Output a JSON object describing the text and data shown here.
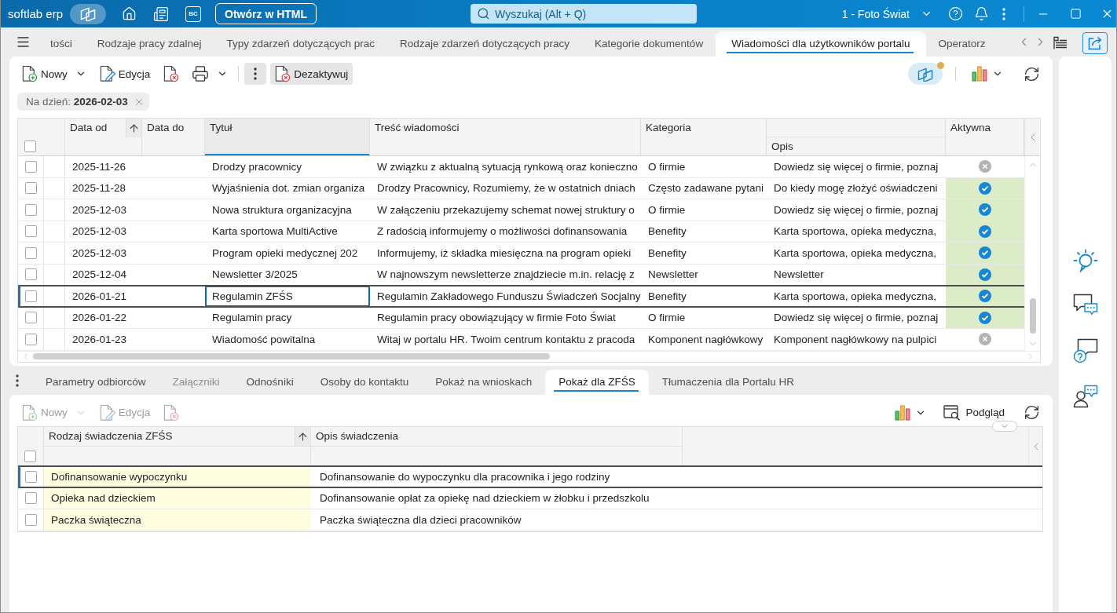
{
  "titlebar": {
    "brand": "softlab erp",
    "bc_badge": "BC",
    "open_html": "Otwórz w HTML",
    "search": {
      "placeholder": "Wyszukaj (Alt + Q)"
    },
    "company": "1 - Foto Świat"
  },
  "tabs": [
    {
      "label": "tości",
      "selected": false
    },
    {
      "label": "Rodzaje pracy zdalnej",
      "selected": false
    },
    {
      "label": "Typy zdarzeń dotyczących prac",
      "selected": false
    },
    {
      "label": "Rodzaje zdarzeń dotyczących pracy",
      "selected": false
    },
    {
      "label": "Kategorie dokumentów",
      "selected": false
    },
    {
      "label": "Wiadomości dla użytkowników portalu",
      "selected": true
    },
    {
      "label": "Operatorz",
      "selected": false
    }
  ],
  "toolbar": {
    "groups": [
      [
        {
          "kind": "new",
          "label": "Nowy",
          "menu": true,
          "disabled": false
        },
        {
          "kind": "edit",
          "label": "Edycja",
          "menu": false,
          "disabled": false
        },
        {
          "kind": "delete",
          "menu": false,
          "disabled": false
        },
        {
          "kind": "print",
          "menu": true,
          "disabled": false
        }
      ],
      [
        {
          "kind": "more",
          "menu": false,
          "disabled": false
        },
        {
          "kind": "deactivate",
          "label": "Dezaktywuj",
          "menu": false,
          "disabled": false
        }
      ]
    ],
    "views_badge": true
  },
  "filter": {
    "text": "Na dzień: **2026-02-03**"
  },
  "grid": {
    "select_all": {
      "checked": false
    },
    "columns": [
      {
        "label": "Data od",
        "kind": "upper",
        "sorted": true,
        "selected": false
      },
      {
        "label": "Data do",
        "kind": "upper",
        "sorted": false,
        "selected": false
      },
      {
        "label": "Tytuł",
        "kind": "upper",
        "sorted": false,
        "selected": true
      },
      {
        "label": "Treść wiadomości",
        "kind": "upper",
        "sorted": false,
        "selected": false
      },
      {
        "label": "Kategoria",
        "kind": "upper",
        "sorted": false,
        "selected": false
      },
      {
        "label": "Opis",
        "kind": "lower",
        "sorted": false,
        "selected": false
      },
      {
        "label": "Aktywna",
        "kind": "upper",
        "sorted": false,
        "selected": false
      }
    ],
    "rows": [
      {
        "checked": false,
        "selected": false,
        "date_from": "2025-11-26",
        "title": "Drodzy pracownicy",
        "content": "W związku z aktualną sytuacją rynkową oraz konieczno",
        "category": "O firmie",
        "description": "Dowiedz się więcej o firmie, poznaj",
        "active": false
      },
      {
        "checked": false,
        "selected": false,
        "date_from": "2025-11-28",
        "title": "Wyjaśnienia dot. zmian organiza",
        "content": "Drodzy Pracownicy, Rozumiemy, że w ostatnich dniach",
        "category": "Często zadawane pytani",
        "description": "Do kiedy mogę złożyć oświadczeni",
        "active": true
      },
      {
        "checked": false,
        "selected": false,
        "date_from": "2025-12-03",
        "title": "Nowa struktura organizacyjna",
        "content": "W załączeniu przekazujemy schemat nowej struktury o",
        "category": "O firmie",
        "description": "Dowiedz się więcej o firmie, poznaj",
        "active": true
      },
      {
        "checked": false,
        "selected": false,
        "date_from": "2025-12-03",
        "title": "Karta sportowa MultiActive",
        "content": "Z radością informujemy o możliwości dofinansowania",
        "category": "Benefity",
        "description": "Karta sportowa, opieka medyczna,",
        "active": true
      },
      {
        "checked": false,
        "selected": false,
        "date_from": "2025-12-03",
        "title": "Program opieki medycznej 202",
        "content": "Informujemy, iż składka miesięczna na program opieki",
        "category": "Benefity",
        "description": "Karta sportowa, opieka medyczna,",
        "active": true
      },
      {
        "checked": false,
        "selected": false,
        "date_from": "2025-12-04",
        "title": "Newsletter 3/2025",
        "content": "W najnowszym newsletterze znajdziecie m.in. relację z",
        "category": "Newsletter",
        "description": "Newsletter",
        "active": true
      },
      {
        "checked": false,
        "selected": true,
        "date_from": "2026-01-21",
        "title": "Regulamin ZFŚS",
        "content": "Regulamin Zakładowego Funduszu Świadczeń Socjalny",
        "category": "Benefity",
        "description": "Karta sportowa, opieka medyczna,",
        "active": true
      },
      {
        "checked": false,
        "selected": false,
        "date_from": "2026-01-22",
        "title": "Regulamin pracy",
        "content": "Regulamin pracy obowiązujący w firmie Foto Świat",
        "category": "O firmie",
        "description": "Dowiedz się więcej o firmie, poznaj",
        "active": true
      },
      {
        "checked": false,
        "selected": false,
        "date_from": "2026-01-23",
        "title": "Wiadomość powitalna",
        "content": "Witaj w portalu HR. Twoim centrum kontaktu z pracoda",
        "category": "Komponent nagłówkowy",
        "description": "Komponent nagłówkowy na pulpici",
        "active": false
      }
    ]
  },
  "detail_tabs": [
    {
      "label": "Parametry odbiorców",
      "selected": false,
      "disabled": false
    },
    {
      "label": "Załączniki",
      "selected": false,
      "disabled": true
    },
    {
      "label": "Odnośniki",
      "selected": false,
      "disabled": false
    },
    {
      "label": "Osoby do kontaktu",
      "selected": false,
      "disabled": false
    },
    {
      "label": "Pokaż na wnioskach",
      "selected": false,
      "disabled": false
    },
    {
      "label": "Pokaż dla ZFŚS",
      "selected": true,
      "disabled": false
    },
    {
      "label": "Tłumaczenia dla Portalu HR",
      "selected": false,
      "disabled": false
    }
  ],
  "detail_toolbar": {
    "items": [
      {
        "kind": "new",
        "label": "Nowy",
        "menu": true,
        "disabled": true
      },
      {
        "kind": "edit",
        "label": "Edycja",
        "menu": false,
        "disabled": true
      },
      {
        "kind": "delete",
        "menu": false,
        "disabled": true
      }
    ],
    "preview": "Podgląd"
  },
  "detail_grid": {
    "select_all": {
      "checked": false
    },
    "columns": [
      {
        "label": "Rodzaj świadczenia ZFŚS",
        "sorted": true,
        "highlighted": true
      },
      {
        "label": "Opis świadczenia",
        "sorted": false,
        "highlighted": false
      }
    ],
    "rows": [
      {
        "checked": false,
        "selected": true,
        "type": "Dofinansowanie wypoczynku",
        "description": "Dofinansowanie do wypoczynku dla pracownika i jego rodziny"
      },
      {
        "checked": false,
        "selected": false,
        "type": "Opieka nad dzieckiem",
        "description": "Dofinansowanie opłat za opiekę nad dzieckiem w żłobku i przedszkolu"
      },
      {
        "checked": false,
        "selected": false,
        "type": "Paczka świąteczna",
        "description": "Paczka świąteczna dla dzieci pracowników"
      }
    ]
  }
}
